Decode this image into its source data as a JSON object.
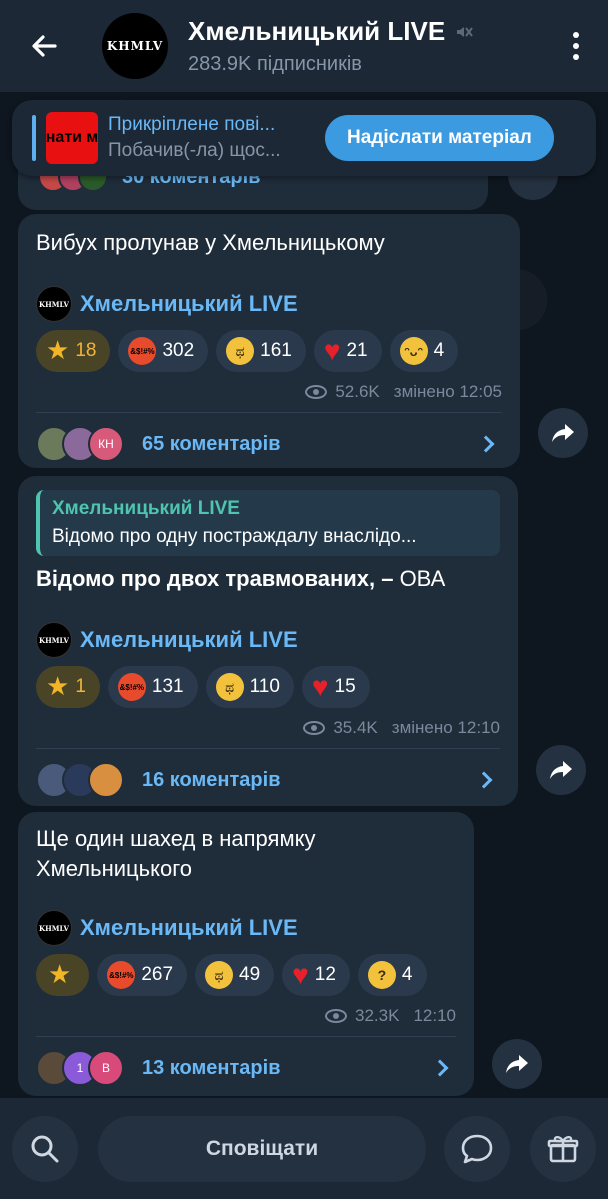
{
  "header": {
    "back_icon": "arrow-left-icon",
    "avatar_text": "KHMLV",
    "title": "Хмельницький LIVE",
    "mute_icon": "muted-speaker-icon",
    "subtitle": "283.9K підписників",
    "menu_icon": "more-vertical-icon"
  },
  "pinned": {
    "thumb_text": "нати м",
    "title": "Прикріплене пові...",
    "subtitle": "Побачив(-ла) щос...",
    "button_label": "Надіслати матеріал"
  },
  "prev_fragment": {
    "comments_label": "30 коментарів"
  },
  "messages": [
    {
      "text": "Вибух пролунав у Хмельницькому",
      "signature_name": "Хмельницький LIVE",
      "signature_avatar": "KHMLV",
      "reactions": [
        {
          "emoji": "star",
          "count": "18"
        },
        {
          "emoji": "angry",
          "count": "302"
        },
        {
          "emoji": "cry",
          "count": "161"
        },
        {
          "emoji": "heart",
          "count": "21"
        },
        {
          "emoji": "grin",
          "count": "4"
        }
      ],
      "views": "52.6K",
      "time": "змінено 12:05",
      "comments": "65 коментарів",
      "comment_avatars": [
        "",
        "",
        "КН"
      ]
    },
    {
      "quote_title": "Хмельницький LIVE",
      "quote_text": "Відомо про одну постраждалу внаслідо...",
      "text_bold": "Відомо про двох травмованих, –",
      "text_rest": " ОВА",
      "signature_name": "Хмельницький LIVE",
      "signature_avatar": "KHMLV",
      "reactions": [
        {
          "emoji": "star",
          "count": "1"
        },
        {
          "emoji": "angry",
          "count": "131"
        },
        {
          "emoji": "cry",
          "count": "110"
        },
        {
          "emoji": "heart",
          "count": "15"
        }
      ],
      "views": "35.4K",
      "time": "змінено 12:10",
      "comments": "16 коментарів"
    },
    {
      "text_line1": "Ще один шахед в напрямку",
      "text_line2": "Хмельницького",
      "signature_name": "Хмельницький LIVE",
      "signature_avatar": "KHMLV",
      "reactions": [
        {
          "emoji": "star",
          "count": ""
        },
        {
          "emoji": "angry",
          "count": "267"
        },
        {
          "emoji": "cry",
          "count": "49"
        },
        {
          "emoji": "heart",
          "count": "12"
        },
        {
          "emoji": "think",
          "count": "4"
        }
      ],
      "views": "32.3K",
      "time": "12:10",
      "comments": "13 коментарів",
      "comment_avatars": [
        "",
        "1",
        "B"
      ]
    }
  ],
  "bottom": {
    "search_icon": "search-icon",
    "notify_label": "Сповіщати",
    "chat_icon": "chat-bubble-icon",
    "gift_icon": "gift-icon"
  },
  "colors": {
    "accent": "#6ab8f5",
    "bubble": "#1f2c3a",
    "header": "#1c2836",
    "button": "#3b9ae0"
  }
}
